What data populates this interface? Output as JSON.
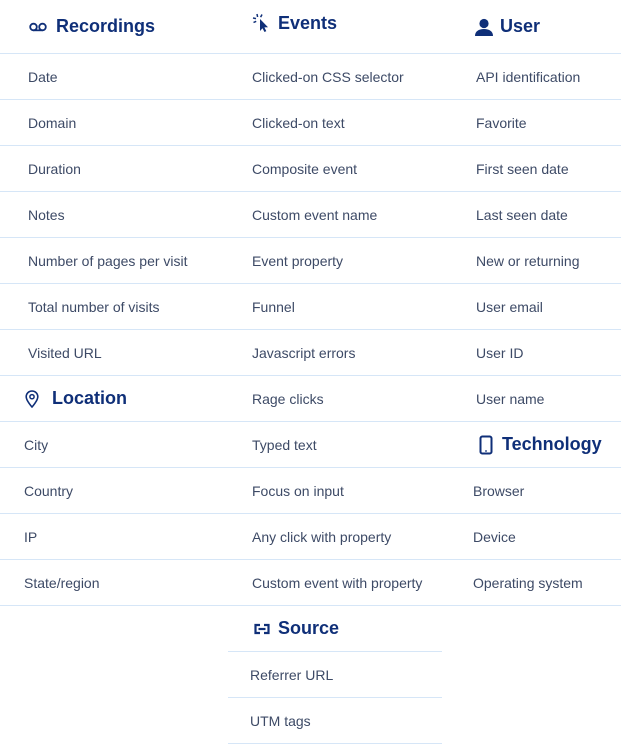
{
  "recordings": {
    "title": "Recordings",
    "icon": "voicemail-icon",
    "items": [
      "Date",
      "Domain",
      "Duration",
      "Notes",
      "Number of pages per visit",
      "Total number of visits",
      "Visited URL"
    ]
  },
  "location": {
    "title": "Location",
    "icon": "map-pin-icon",
    "items": [
      "City",
      "Country",
      "IP",
      "State/region"
    ]
  },
  "events": {
    "title": "Events",
    "icon": "cursor-click-icon",
    "items": [
      "Clicked-on CSS selector",
      "Clicked-on text",
      "Composite event",
      "Custom event name",
      "Event property",
      "Funnel",
      "Javascript errors",
      "Rage clicks",
      "Typed text",
      "Focus on input",
      "Any click with property",
      "Custom event with property"
    ]
  },
  "source": {
    "title": "Source",
    "icon": "link-icon",
    "items": [
      "Referrer URL",
      "UTM tags"
    ]
  },
  "user": {
    "title": "User",
    "icon": "user-icon",
    "items": [
      "API identification",
      "Favorite",
      "First seen date",
      "Last seen date",
      "New or returning",
      "User email",
      "User ID",
      "User name"
    ]
  },
  "technology": {
    "title": "Technology",
    "icon": "smartphone-icon",
    "items": [
      "Browser",
      "Device",
      "Operating system"
    ]
  }
}
